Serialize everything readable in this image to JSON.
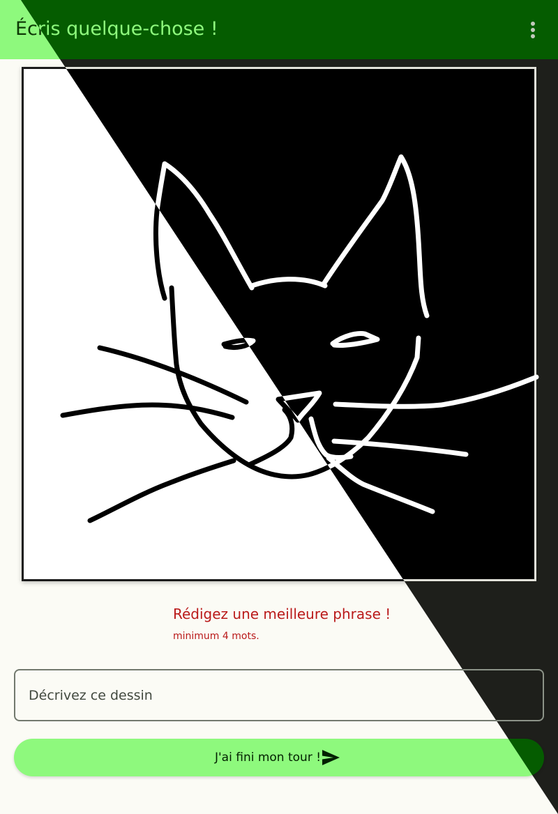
{
  "app_bar": {
    "title": "Écris quelque-chose !",
    "menu_icon": "more-vert-icon"
  },
  "drawing": {
    "subject": "cat-face-sketch"
  },
  "validation": {
    "message": "Rédigez une meilleure phrase !",
    "hint": "minimum 4 mots."
  },
  "input": {
    "value": "",
    "placeholder": "Décrivez ce dessin"
  },
  "submit": {
    "label": "J'ai fini mon tour !",
    "icon": "send-icon"
  },
  "colors": {
    "light_primary_container": "#8EF97D",
    "dark_primary_container": "#055C00",
    "error_light": "#BA1A1A",
    "error_dark": "#FFB4AB",
    "background_light": "#FBFBF5",
    "background_dark": "#1E1F1B"
  }
}
